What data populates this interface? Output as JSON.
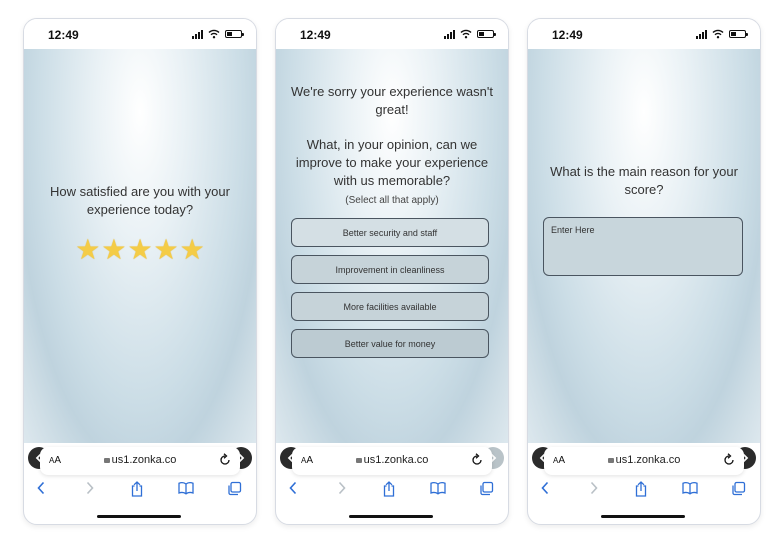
{
  "status": {
    "time": "12:49"
  },
  "browser": {
    "text_size_label": "AA",
    "url": "us1.zonka.co"
  },
  "screen1": {
    "question": "How satisfied are you with your experience today?",
    "rating": 5,
    "rating_max": 5
  },
  "screen2": {
    "sorry_text": "We're sorry your experience wasn't great!",
    "question": "What, in your opinion, can we improve to make your experience with us memorable?",
    "hint": "(Select all that apply)",
    "options": [
      "Better security and staff",
      "Improvement in cleanliness",
      "More facilities available",
      "Better value for money"
    ]
  },
  "screen3": {
    "question": "What is the main reason for your score?",
    "input_placeholder": "Enter Here"
  },
  "colors": {
    "star": "#f4cc47",
    "nav_button": "#2b2b2b",
    "nav_disabled": "#b9c3c8",
    "browser_accent": "#2f6fd6"
  }
}
